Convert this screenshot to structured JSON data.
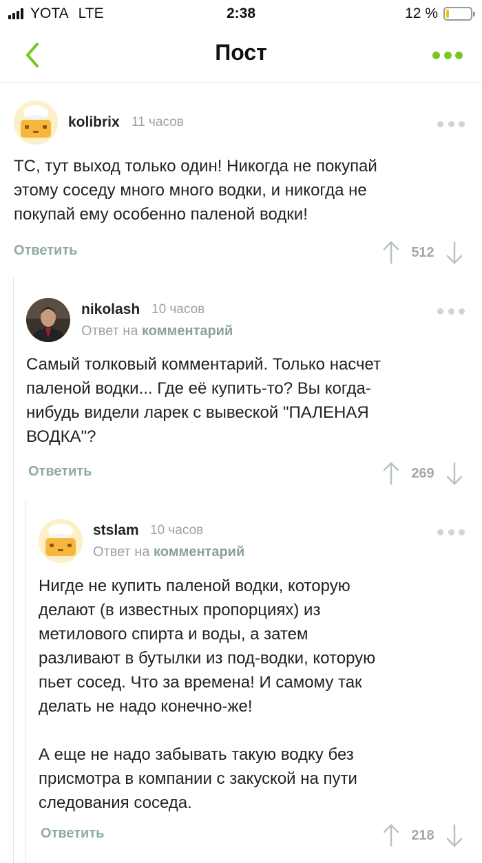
{
  "status_bar": {
    "carrier": "YOTA",
    "network": "LTE",
    "time": "2:38",
    "battery_pct": "12 %",
    "battery_level": 0.12
  },
  "navbar": {
    "title": "Пост",
    "accent_color": "#7cc520"
  },
  "comments": [
    {
      "author": "kolibrix",
      "time": "11 часов",
      "avatar": "default-hat-avatar",
      "text": "ТС, тут выход только один! Никогда не покупай\nэтому соседу много много водки, и никогда не\nпокупай ему особенно паленой водки!",
      "reply_label": "Ответить",
      "score": "512"
    },
    {
      "author": "nikolash",
      "time": "10 часов",
      "avatar": "user-photo-avatar",
      "reply_prefix": "Ответ на",
      "reply_link": "комментарий",
      "text": "Самый толковый комментарий. Только насчет\nпаленой водки... Где её купить-то? Вы когда-\nнибудь видели ларек с вывеской \"ПАЛЕНАЯ\nВОДКА\"?",
      "reply_label": "Ответить",
      "score": "269"
    },
    {
      "author": "stslam",
      "time": "10 часов",
      "avatar": "default-hat-avatar",
      "reply_prefix": "Ответ на",
      "reply_link": "комментарий",
      "text": "Нигде не купить паленой водки, которую\nделают (в известных пропорциях) из\nметилового спирта и воды, а затем\nразливают в бутылки из под-водки, которую\nпьет сосед. Что за времена! И самому так\nделать не надо конечно-же!\n\nА еще не надо забывать такую водку без\nприсмотра в компании с закуской на пути\nследования соседа.",
      "reply_label": "Ответить",
      "score": "218"
    }
  ]
}
